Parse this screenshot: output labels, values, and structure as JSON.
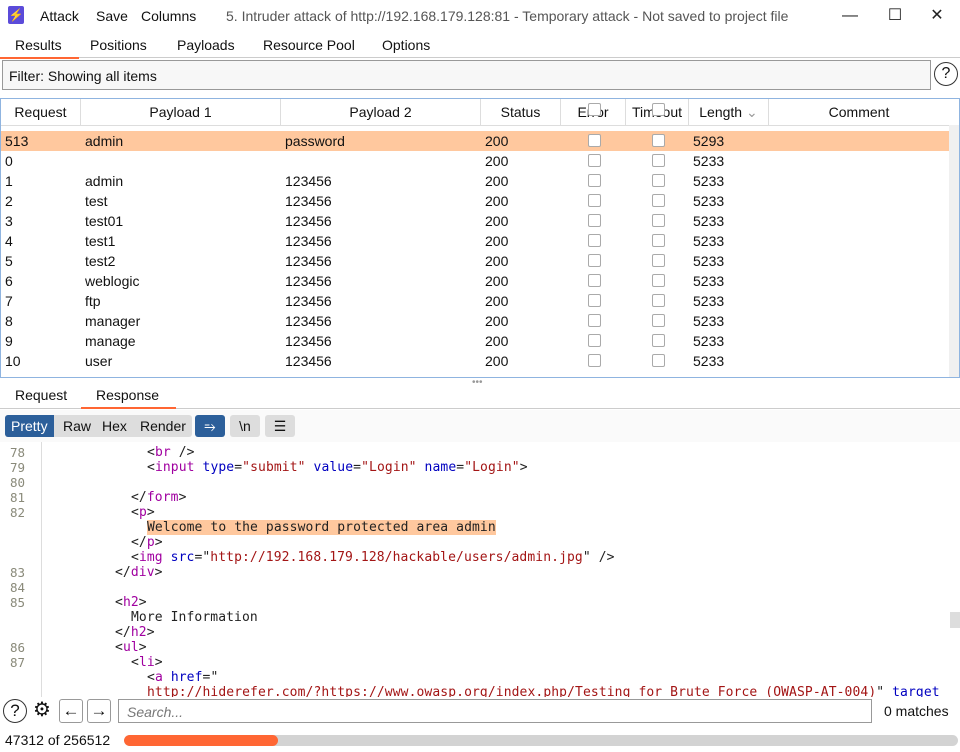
{
  "window": {
    "title": "5. Intruder attack of http://192.168.179.128:81 - Temporary attack - Not saved to project file",
    "menu": [
      "Attack",
      "Save",
      "Columns"
    ],
    "minimize": "—",
    "maximize": "☐",
    "close": "✕",
    "logo": "⚡"
  },
  "tabs": [
    "Results",
    "Positions",
    "Payloads",
    "Resource Pool",
    "Options"
  ],
  "filter": {
    "text": "Filter: Showing all items",
    "help": "?"
  },
  "table": {
    "columns": [
      "Request",
      "Payload 1",
      "Payload 2",
      "Status",
      "Error",
      "Timeout",
      "Length",
      "Comment"
    ],
    "sort_icon": "⌄",
    "rows": [
      {
        "request": "513",
        "p1": "admin",
        "p2": "password",
        "status": "200",
        "length": "5293",
        "selected": true
      },
      {
        "request": "0",
        "p1": "",
        "p2": "",
        "status": "200",
        "length": "5233"
      },
      {
        "request": "1",
        "p1": "admin",
        "p2": "123456",
        "status": "200",
        "length": "5233"
      },
      {
        "request": "2",
        "p1": "test",
        "p2": "123456",
        "status": "200",
        "length": "5233"
      },
      {
        "request": "3",
        "p1": "test01",
        "p2": "123456",
        "status": "200",
        "length": "5233"
      },
      {
        "request": "4",
        "p1": "test1",
        "p2": "123456",
        "status": "200",
        "length": "5233"
      },
      {
        "request": "5",
        "p1": "test2",
        "p2": "123456",
        "status": "200",
        "length": "5233"
      },
      {
        "request": "6",
        "p1": "weblogic",
        "p2": "123456",
        "status": "200",
        "length": "5233"
      },
      {
        "request": "7",
        "p1": "ftp",
        "p2": "123456",
        "status": "200",
        "length": "5233"
      },
      {
        "request": "8",
        "p1": "manager",
        "p2": "123456",
        "status": "200",
        "length": "5233"
      },
      {
        "request": "9",
        "p1": "manage",
        "p2": "123456",
        "status": "200",
        "length": "5233"
      },
      {
        "request": "10",
        "p1": "user",
        "p2": "123456",
        "status": "200",
        "length": "5233"
      }
    ]
  },
  "subtabs": [
    "Request",
    "Response"
  ],
  "view": {
    "modes": [
      "Pretty",
      "Raw",
      "Hex",
      "Render"
    ],
    "wrap_icon": "⥱",
    "newline": "\\n",
    "menu_icon": "☰"
  },
  "colors": {
    "accent": "#ff6633",
    "highlight": "#ffc89e",
    "selected": "#2c5f9a",
    "tag": "#a000a0",
    "attr": "#0000c0",
    "string": "#a31515"
  },
  "code": [
    {
      "n": "78",
      "i": 12,
      "t": [
        [
          "<",
          "p"
        ],
        [
          "br",
          "tag"
        ],
        [
          " />",
          "p"
        ]
      ]
    },
    {
      "n": "79",
      "i": 12,
      "t": [
        [
          "<",
          "p"
        ],
        [
          "input",
          "tag"
        ],
        [
          " ",
          "p"
        ],
        [
          "type",
          "attr"
        ],
        [
          "=",
          "p"
        ],
        [
          "\"submit\"",
          "string"
        ],
        [
          " ",
          "p"
        ],
        [
          "value",
          "attr"
        ],
        [
          "=",
          "p"
        ],
        [
          "\"Login\"",
          "string"
        ],
        [
          " ",
          "p"
        ],
        [
          "name",
          "attr"
        ],
        [
          "=",
          "p"
        ],
        [
          "\"Login\"",
          "string"
        ],
        [
          ">",
          "p"
        ]
      ]
    },
    {
      "n": "80",
      "i": 0,
      "t": []
    },
    {
      "n": "81",
      "i": 10,
      "t": [
        [
          "</",
          "p"
        ],
        [
          "form",
          "tag"
        ],
        [
          ">",
          "p"
        ]
      ]
    },
    {
      "n": "82",
      "i": 10,
      "t": [
        [
          "<",
          "p"
        ],
        [
          "p",
          "tag"
        ],
        [
          ">",
          "p"
        ]
      ]
    },
    {
      "n": "",
      "i": 12,
      "t": [
        [
          "Welcome to the password protected area admin",
          "hl"
        ]
      ]
    },
    {
      "n": "",
      "i": 10,
      "t": [
        [
          "</",
          "p"
        ],
        [
          "p",
          "tag"
        ],
        [
          ">",
          "p"
        ]
      ]
    },
    {
      "n": "",
      "i": 10,
      "t": [
        [
          "<",
          "p"
        ],
        [
          "img",
          "tag"
        ],
        [
          " ",
          "p"
        ],
        [
          "src",
          "attr"
        ],
        [
          "=\"",
          "p"
        ],
        [
          "http://192.168.179.128/hackable/users/admin.jpg",
          "string"
        ],
        [
          "\" />",
          "p"
        ]
      ]
    },
    {
      "n": "83",
      "i": 8,
      "t": [
        [
          "</",
          "p"
        ],
        [
          "div",
          "tag"
        ],
        [
          ">",
          "p"
        ]
      ]
    },
    {
      "n": "84",
      "i": 0,
      "t": []
    },
    {
      "n": "85",
      "i": 8,
      "t": [
        [
          "<",
          "p"
        ],
        [
          "h2",
          "tag"
        ],
        [
          ">",
          "p"
        ]
      ]
    },
    {
      "n": "",
      "i": 10,
      "t": [
        [
          "More Information",
          "p"
        ]
      ]
    },
    {
      "n": "",
      "i": 8,
      "t": [
        [
          "</",
          "p"
        ],
        [
          "h2",
          "tag"
        ],
        [
          ">",
          "p"
        ]
      ]
    },
    {
      "n": "86",
      "i": 8,
      "t": [
        [
          "<",
          "p"
        ],
        [
          "ul",
          "tag"
        ],
        [
          ">",
          "p"
        ]
      ]
    },
    {
      "n": "87",
      "i": 10,
      "t": [
        [
          "<",
          "p"
        ],
        [
          "li",
          "tag"
        ],
        [
          ">",
          "p"
        ]
      ]
    },
    {
      "n": "",
      "i": 12,
      "t": [
        [
          "<",
          "p"
        ],
        [
          "a",
          "tag"
        ],
        [
          " ",
          "p"
        ],
        [
          "href",
          "attr"
        ],
        [
          "=\"",
          "p"
        ]
      ]
    },
    {
      "n": "",
      "i": 12,
      "t": [
        [
          "http://hiderefer.com/?https://www.owasp.org/index.php/Testing_for_Brute_Force_(OWASP-AT-004)",
          "string"
        ],
        [
          "\" ",
          "p"
        ],
        [
          "target",
          "attr"
        ]
      ]
    }
  ],
  "bottom": {
    "help": "?",
    "settings": "⚙",
    "prev": "←",
    "next": "→",
    "search_placeholder": "Search...",
    "matches": "0 matches"
  },
  "progress": {
    "text": "47312 of 256512",
    "done": 47312,
    "total": 256512
  }
}
